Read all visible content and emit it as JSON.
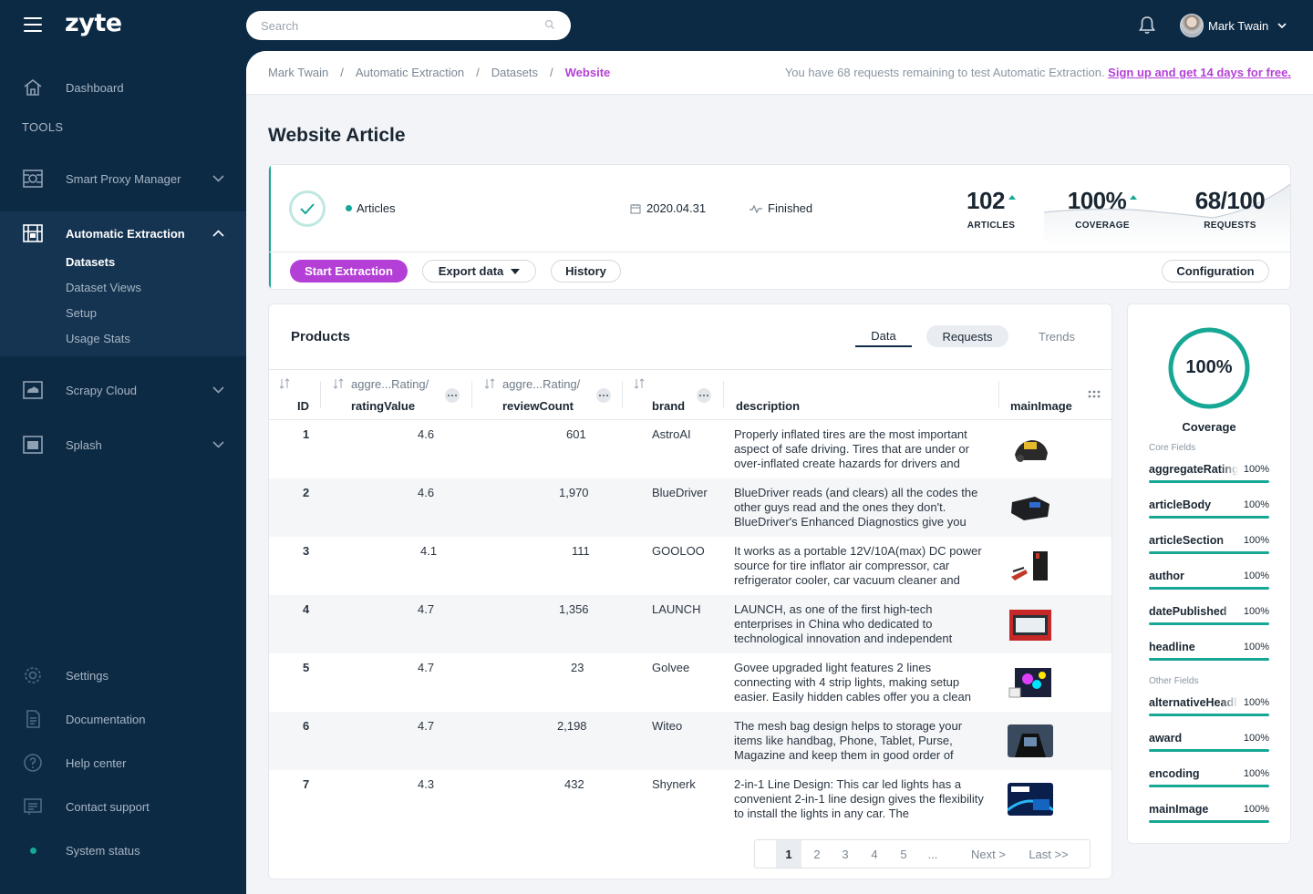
{
  "topbar": {
    "logo": "zyte",
    "search_placeholder": "Search",
    "user_name": "Mark Twain"
  },
  "sidebar": {
    "dashboard": "Dashboard",
    "tools_header": "TOOLS",
    "smart_proxy": "Smart Proxy Manager",
    "auto_extraction": "Automatic Extraction",
    "sub": [
      "Datasets",
      "Dataset Views",
      "Setup",
      "Usage Stats"
    ],
    "scrapy_cloud": "Scrapy Cloud",
    "splash": "Splash",
    "settings": "Settings",
    "documentation": "Documentation",
    "help_center": "Help center",
    "contact_support": "Contact support",
    "system_status": "System status"
  },
  "breadcrumb": [
    "Mark Twain",
    "Automatic Extraction",
    "Datasets",
    "Website"
  ],
  "notice": {
    "text": "You have 68 requests remaining to test Automatic Extraction.",
    "link": "Sign up and get 14 days for free."
  },
  "page_title": "Website Article",
  "summary": {
    "type": "Articles",
    "date": "2020.04.31",
    "status": "Finished",
    "metrics": [
      {
        "value": "102",
        "label": "ARTICLES"
      },
      {
        "value": "100%",
        "label": "COVERAGE"
      },
      {
        "value": "68/100",
        "label": "REQUESTS"
      }
    ],
    "buttons": {
      "start": "Start Extraction",
      "export": "Export data",
      "history": "History",
      "config": "Configuration"
    }
  },
  "products": {
    "title": "Products",
    "tabs": [
      "Data",
      "Requests",
      "Trends"
    ],
    "columns": {
      "id": "ID",
      "rating_top": "aggre...Rating/",
      "rating_bottom": "ratingValue",
      "review_top": "aggre...Rating/",
      "review_bottom": "reviewCount",
      "brand": "brand",
      "description": "description",
      "image": "mainImage"
    },
    "rows": [
      {
        "id": "1",
        "rating": "4.6",
        "reviews": "601",
        "brand": "AstroAI",
        "desc": "Properly inflated tires are the most important aspect of safe driving. Tires that are under or over-inflated create hazards for drivers and"
      },
      {
        "id": "2",
        "rating": "4.6",
        "reviews": "1,970",
        "brand": "BlueDriver",
        "desc": "BlueDriver reads (and clears) all the codes the other guys read and the ones they don't. BlueDriver's Enhanced Diagnostics give you"
      },
      {
        "id": "3",
        "rating": "4.1",
        "reviews": "111",
        "brand": "GOOLOO",
        "desc": "It works as a portable 12V/10A(max) DC power source for tire inflator air compressor, car refrigerator cooler, car vacuum cleaner and"
      },
      {
        "id": "4",
        "rating": "4.7",
        "reviews": "1,356",
        "brand": "LAUNCH",
        "desc": "LAUNCH, as one of the first high-tech enterprises in China who dedicated to technological innovation and independent"
      },
      {
        "id": "5",
        "rating": "4.7",
        "reviews": "23",
        "brand": "Golvee",
        "desc": "Govee upgraded light features 2 lines connecting with 4 strip lights, making setup easier.  Easily hidden cables offer you a clean"
      },
      {
        "id": "6",
        "rating": "4.7",
        "reviews": "2,198",
        "brand": "Witeo",
        "desc": "The mesh bag design helps to storage your items like handbag, Phone, Tablet, Purse, Magazine and keep them in good order of"
      },
      {
        "id": "7",
        "rating": "4.3",
        "reviews": "432",
        "brand": "Shynerk",
        "desc": "2-in-1 Line Design: This car led lights has a convenient 2-in-1 line design gives the flexibility to install the lights in any car.  The"
      }
    ],
    "pager": [
      "1",
      "2",
      "3",
      "4",
      "5",
      "...",
      "Next >",
      "Last >>"
    ]
  },
  "coverage": {
    "percent": "100%",
    "fill_fraction": 1.0,
    "title": "Coverage",
    "core_label": "Core Fields",
    "other_label": "Other Fields",
    "core": [
      {
        "name": "aggregateRating",
        "pct": "100%"
      },
      {
        "name": "articleBody",
        "pct": "100%"
      },
      {
        "name": "articleSection",
        "pct": "100%"
      },
      {
        "name": "author",
        "pct": "100%"
      },
      {
        "name": "datePublished",
        "pct": "100%"
      },
      {
        "name": "headline",
        "pct": "100%"
      }
    ],
    "other": [
      {
        "name": "alternativeHeadline",
        "pct": "100%"
      },
      {
        "name": "award",
        "pct": "100%"
      },
      {
        "name": "encoding",
        "pct": "100%"
      },
      {
        "name": "mainImage",
        "pct": "100%"
      }
    ]
  },
  "colors": {
    "accent": "#b43fd6",
    "teal": "#17a895",
    "navy": "#0d2a45"
  }
}
